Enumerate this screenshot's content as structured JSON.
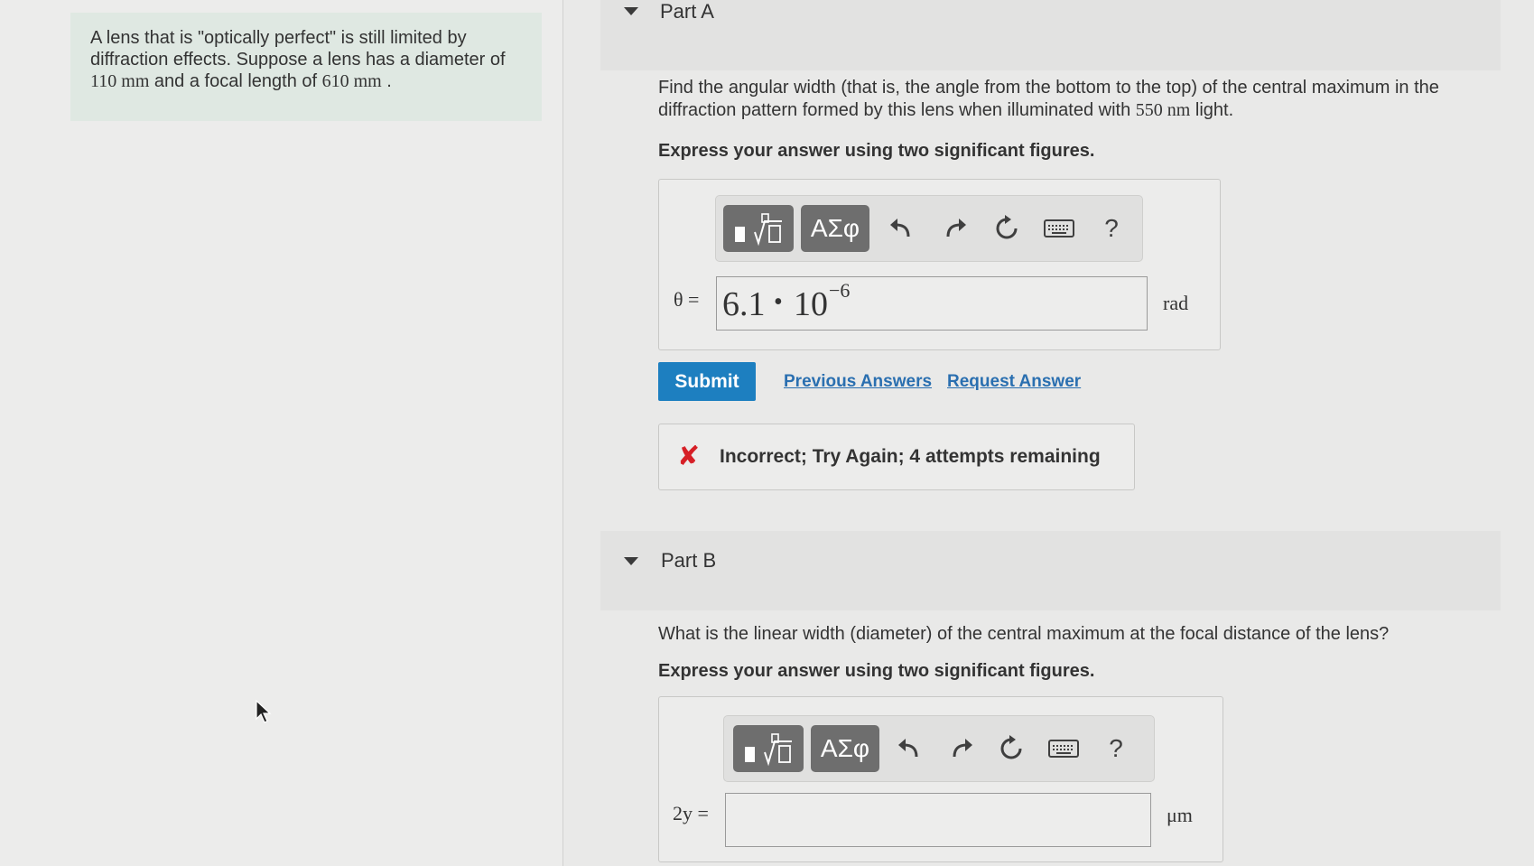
{
  "problem": {
    "text_1": "A lens that is \"optically perfect\" is still limited by diffraction effects. Suppose a lens has a diameter of ",
    "diameter": "110 mm",
    "text_2": " and a focal length of ",
    "focal_length": "610 mm",
    "text_3": " ."
  },
  "part_a": {
    "title": "Part A",
    "question_1": "Find the angular width (that is, the angle from the bottom to the top) of the central maximum in the diffraction pattern formed by this lens when illuminated with ",
    "wavelength": "550 nm",
    "question_2": " light.",
    "instruction": "Express your answer using two significant figures.",
    "variable": "θ =",
    "answer_mantissa": "6.1",
    "answer_dot": "•",
    "answer_base": "10",
    "answer_exponent": "−6",
    "unit": "rad",
    "submit_label": "Submit",
    "previous_answers_label": "Previous Answers",
    "request_answer_label": "Request Answer",
    "feedback_icon": "✘",
    "feedback": "Incorrect; Try Again; 4 attempts remaining"
  },
  "part_b": {
    "title": "Part B",
    "question": "What is the linear width (diameter) of the central maximum at the focal distance of the lens?",
    "instruction": "Express your answer using two significant figures.",
    "variable": "2y =",
    "answer_value": "",
    "unit": "μm"
  },
  "toolbar": {
    "greek_label": "ΑΣφ",
    "help_label": "?",
    "icons": [
      "templates-icon",
      "greek-symbols-icon",
      "undo-icon",
      "redo-icon",
      "reset-icon",
      "keyboard-icon",
      "help-icon"
    ]
  },
  "colors": {
    "submit": "#1d7fc0",
    "link": "#2a6fb0",
    "error": "#d61f26",
    "problem_bg": "#dfe8e2"
  }
}
